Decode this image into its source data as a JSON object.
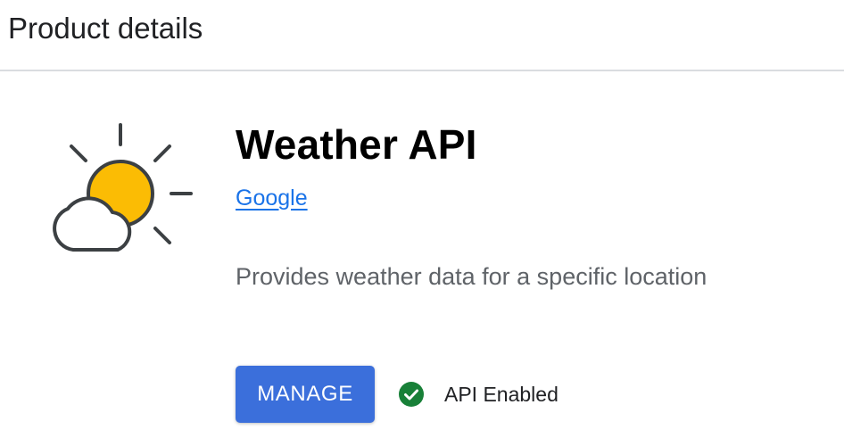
{
  "header": {
    "title": "Product details"
  },
  "product": {
    "icon": "weather-sun-cloud-icon",
    "name": "Weather API",
    "vendor": "Google",
    "description": "Provides weather data for a specific location"
  },
  "actions": {
    "manage_label": "MANAGE"
  },
  "status": {
    "icon": "check-circle-icon",
    "text": "API Enabled"
  },
  "colors": {
    "primary_button": "#3b6fdb",
    "link": "#1a73e8",
    "sun": "#fbbc04",
    "success": "#188038",
    "divider": "#dadce0"
  }
}
